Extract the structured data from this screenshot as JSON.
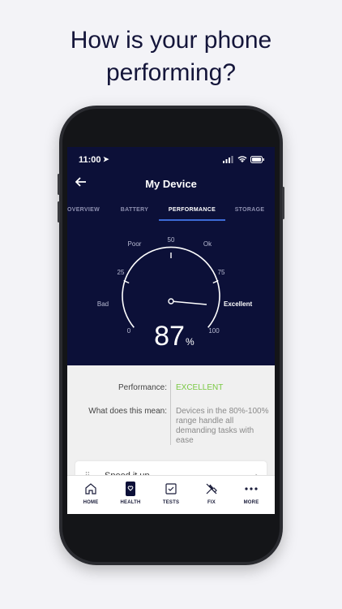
{
  "headline": {
    "line1": "How is your phone",
    "line2": "performing?"
  },
  "status_bar": {
    "time": "11:00"
  },
  "nav": {
    "back_icon": "arrow-left-icon",
    "title": "My Device"
  },
  "tabs": [
    {
      "label": "OVERVIEW",
      "active": false
    },
    {
      "label": "BATTERY",
      "active": false
    },
    {
      "label": "PERFORMANCE",
      "active": true
    },
    {
      "label": "STORAGE",
      "active": false
    }
  ],
  "gauge": {
    "value": 87,
    "unit": "%",
    "min_label": "0",
    "max_label": "100",
    "tick_25": "25",
    "tick_50": "50",
    "tick_75": "75",
    "label_bad": "Bad",
    "label_poor": "Poor",
    "label_ok": "Ok",
    "label_excellent": "Excellent"
  },
  "details": {
    "performance_label": "Performance:",
    "performance_value": "EXCELLENT",
    "meaning_label": "What does this mean:",
    "meaning_value": "Devices in the 80%-100% range handle all demanding tasks with ease"
  },
  "speed_card": {
    "label": "Speed it up",
    "icon": "sliders-icon"
  },
  "bottom_nav": [
    {
      "label": "HOME",
      "icon": "home-icon"
    },
    {
      "label": "HEALTH",
      "icon": "health-icon"
    },
    {
      "label": "TESTS",
      "icon": "tests-icon"
    },
    {
      "label": "FIX",
      "icon": "tools-icon"
    },
    {
      "label": "MORE",
      "icon": "more-icon"
    }
  ],
  "colors": {
    "dark_bg": "#0c1038",
    "accent_green": "#7ac943",
    "tab_underline": "#3d6ad6"
  }
}
